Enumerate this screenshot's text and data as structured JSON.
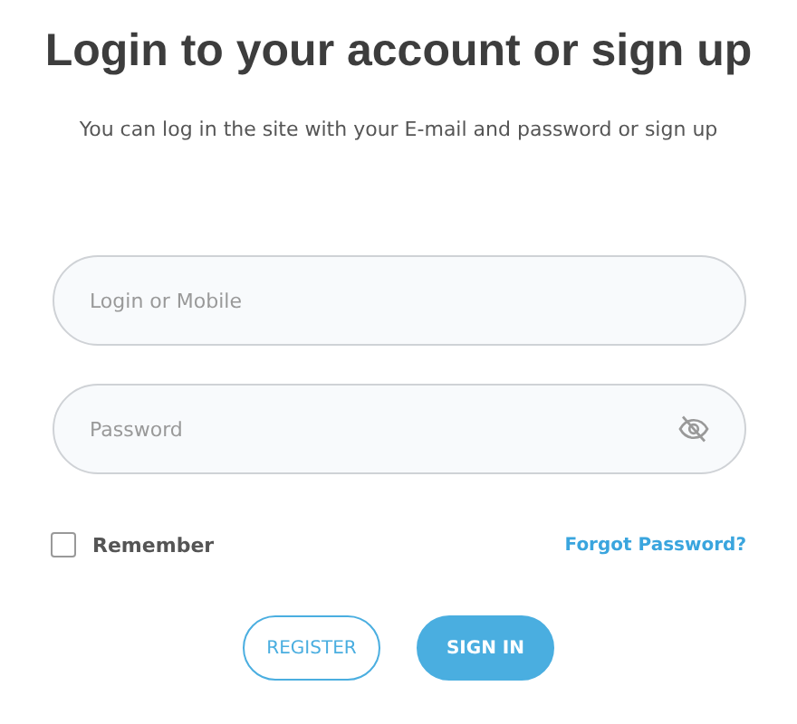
{
  "title": "Login to your account or sign up",
  "subtitle": "You can log in the site with your E-mail and password or sign up",
  "fields": [
    {
      "kind": "text",
      "placeholder": "Login or Mobile"
    },
    {
      "kind": "password",
      "placeholder": "Password"
    }
  ],
  "remember": {
    "label": "Remember",
    "checked": false
  },
  "forgot_link": "Forgot Password?",
  "buttons": [
    {
      "kind": "outline",
      "label": "REGISTER"
    },
    {
      "kind": "primary",
      "label": "SIGN IN"
    }
  ]
}
